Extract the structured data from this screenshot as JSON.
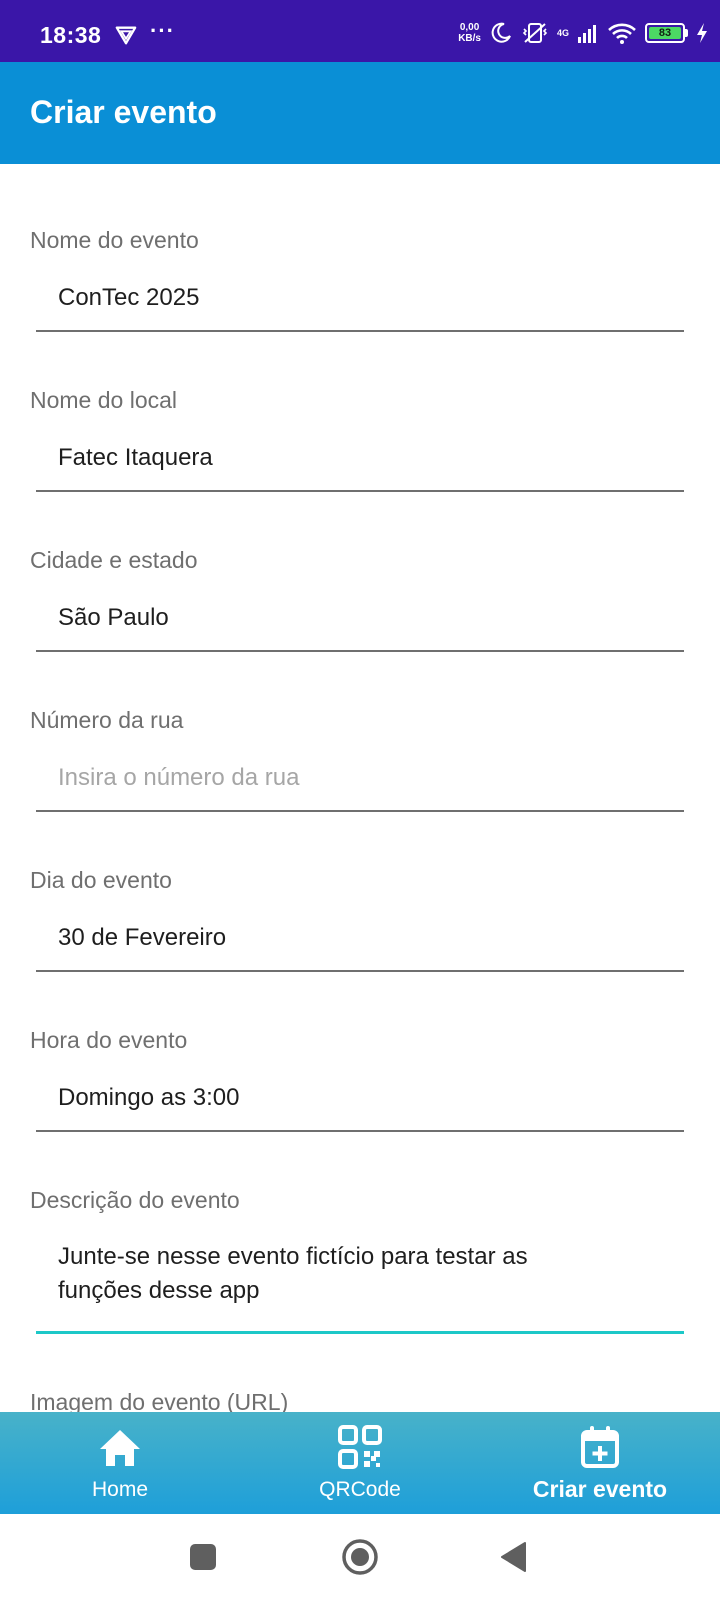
{
  "status_bar": {
    "time": "18:38",
    "more": "···",
    "speed_value": "0,00",
    "speed_unit": "KB/s",
    "network": "4G",
    "battery": "83"
  },
  "app_bar": {
    "title": "Criar evento"
  },
  "form": {
    "fields": [
      {
        "label": "Nome do evento",
        "value": "ConTec 2025",
        "placeholder": ""
      },
      {
        "label": "Nome do local",
        "value": "Fatec Itaquera",
        "placeholder": ""
      },
      {
        "label": "Cidade e estado",
        "value": "São Paulo",
        "placeholder": ""
      },
      {
        "label": "Número da rua",
        "value": "",
        "placeholder": "Insira o número da rua"
      },
      {
        "label": "Dia do evento",
        "value": "30 de Fevereiro",
        "placeholder": ""
      },
      {
        "label": "Hora do evento",
        "value": "Domingo as 3:00",
        "placeholder": ""
      },
      {
        "label": "Descrição do evento",
        "value": "Junte-se nesse evento fictício para testar as funções desse app",
        "placeholder": ""
      },
      {
        "label": "Imagem do evento (URL)",
        "value": "",
        "placeholder": ""
      }
    ]
  },
  "bottom_nav": {
    "items": [
      {
        "label": "Home",
        "icon": "home-icon",
        "active": false
      },
      {
        "label": "QRCode",
        "icon": "qrcode-icon",
        "active": false
      },
      {
        "label": "Criar evento",
        "icon": "calendar-plus-icon",
        "active": true
      }
    ]
  },
  "colors": {
    "status_bar": "#3a16a8",
    "app_bar": "#0a8fd6",
    "focused_underline": "#1cc8c8",
    "bottom_nav": "#1e9fd9"
  }
}
